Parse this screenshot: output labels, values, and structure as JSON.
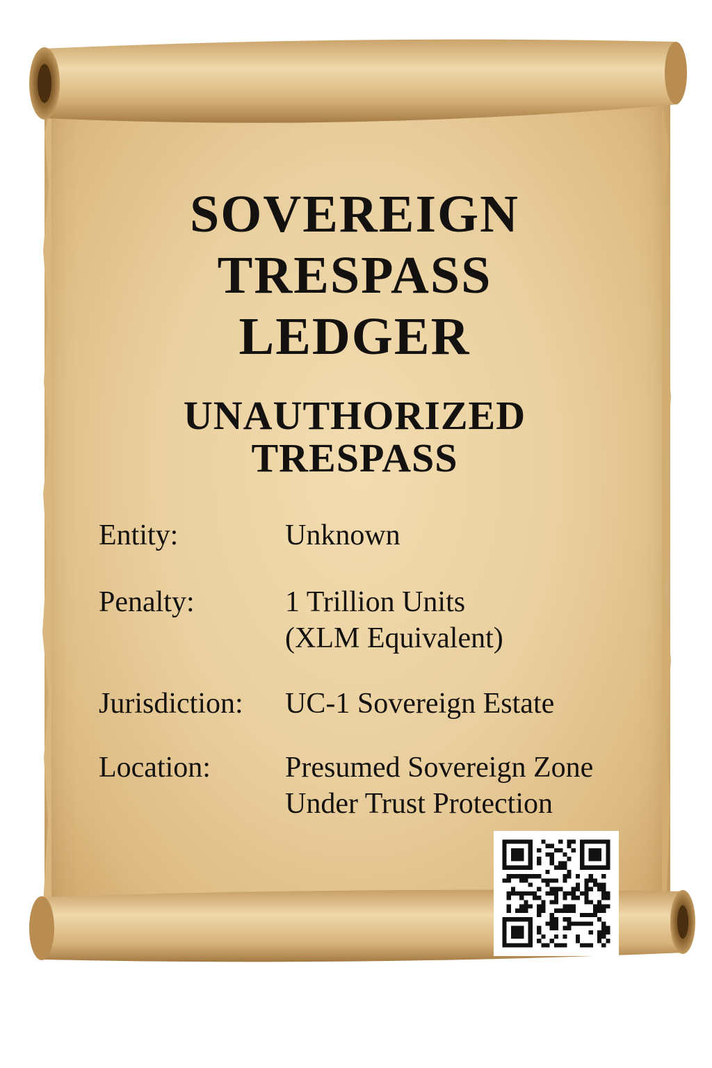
{
  "title_lines": [
    "SOVEREIGN",
    "TRESPASS",
    "LEDGER"
  ],
  "subtitle_lines": [
    "UNAUTHORIZED",
    "TRESPASS"
  ],
  "fields": [
    {
      "label": "Entity:",
      "value_lines": [
        "Unknown"
      ]
    },
    {
      "label": "Penalty:",
      "value_lines": [
        "1 Trillion Units",
        "(XLM Equivalent)"
      ]
    },
    {
      "label": "Jurisdiction:",
      "value_lines": [
        "UC-1 Sovereign Estate"
      ]
    },
    {
      "label": "Location:",
      "value_lines": [
        "Presumed Sovereign Zone",
        "Under Trust Protection"
      ]
    }
  ],
  "colors": {
    "parchment": "#ead0a0",
    "parchment_dark": "#c9a066",
    "ink": "#141210",
    "qr_module": "#111111"
  },
  "icons": {
    "qr": "qr-code-icon"
  }
}
